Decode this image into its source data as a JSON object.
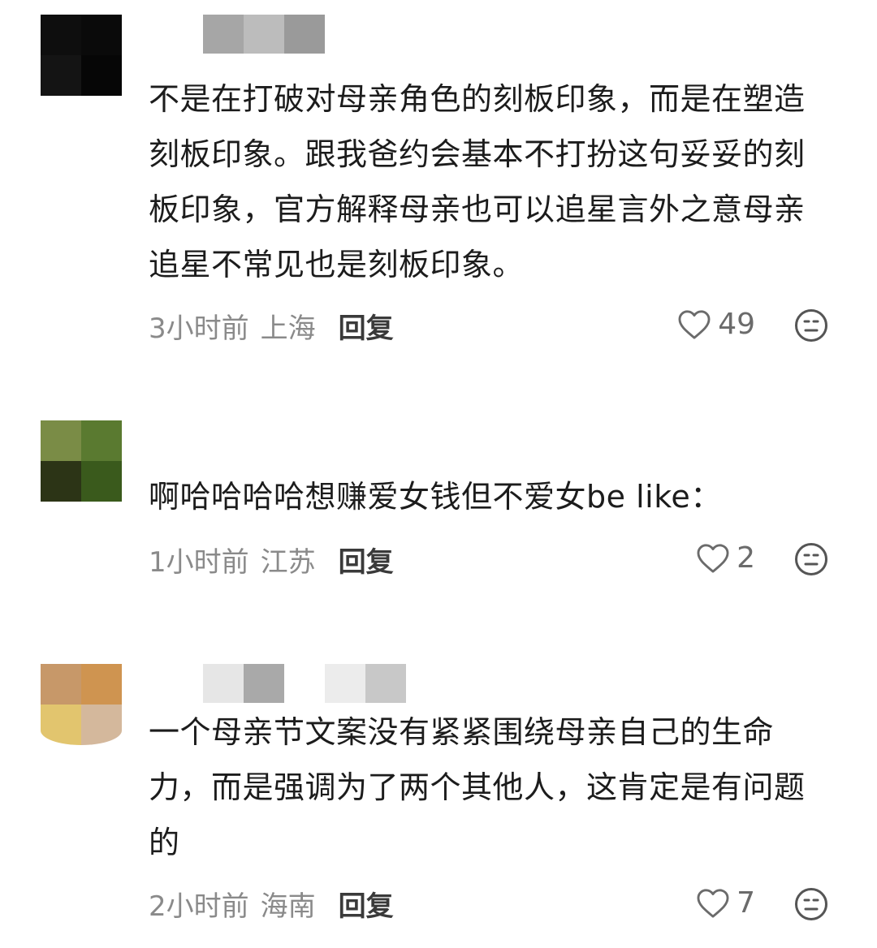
{
  "comments": [
    {
      "avatar_colors": [
        "#0e0e0e",
        "#0a0a0a",
        "#141414",
        "#060606"
      ],
      "username_blur_colors": [
        "#a6a6a6",
        "#bcbcbc",
        "#9a9a9a"
      ],
      "text": "不是在打破对母亲角色的刻板印象，而是在塑造刻板印象。跟我爸约会基本不打扮这句妥妥的刻板印象，官方解释母亲也可以追星言外之意母亲追星不常见也是刻板印象。",
      "time": "3小时前",
      "location": "上海",
      "reply_label": "回复",
      "likes": "49",
      "like_icon": "heart-outline-icon",
      "dislike_icon": "dislike-face-icon"
    },
    {
      "avatar_colors": [
        "#7a8c46",
        "#5a7a30",
        "#2c3416",
        "#3a5a1c"
      ],
      "username_blur_colors": [],
      "text": "啊哈哈哈哈想赚爱女钱但不爱女be like：",
      "time": "1小时前",
      "location": "江苏",
      "reply_label": "回复",
      "likes": "2",
      "like_icon": "heart-outline-icon",
      "dislike_icon": "dislike-face-icon"
    },
    {
      "avatar_colors": [
        "#c79869",
        "#cf9450",
        "#e2c56e",
        "#d4b89c"
      ],
      "username_blur_colors": [
        "#e6e6e6",
        "#a9a9a9",
        "#ffffff",
        "#ececec",
        "#c8c8c8"
      ],
      "text": "一个母亲节文案没有紧紧围绕母亲自己的生命力，而是强调为了两个其他人，这肯定是有问题的",
      "time": "2小时前",
      "location": "海南",
      "reply_label": "回复",
      "likes": "7",
      "like_icon": "heart-outline-icon",
      "dislike_icon": "dislike-face-icon"
    }
  ]
}
